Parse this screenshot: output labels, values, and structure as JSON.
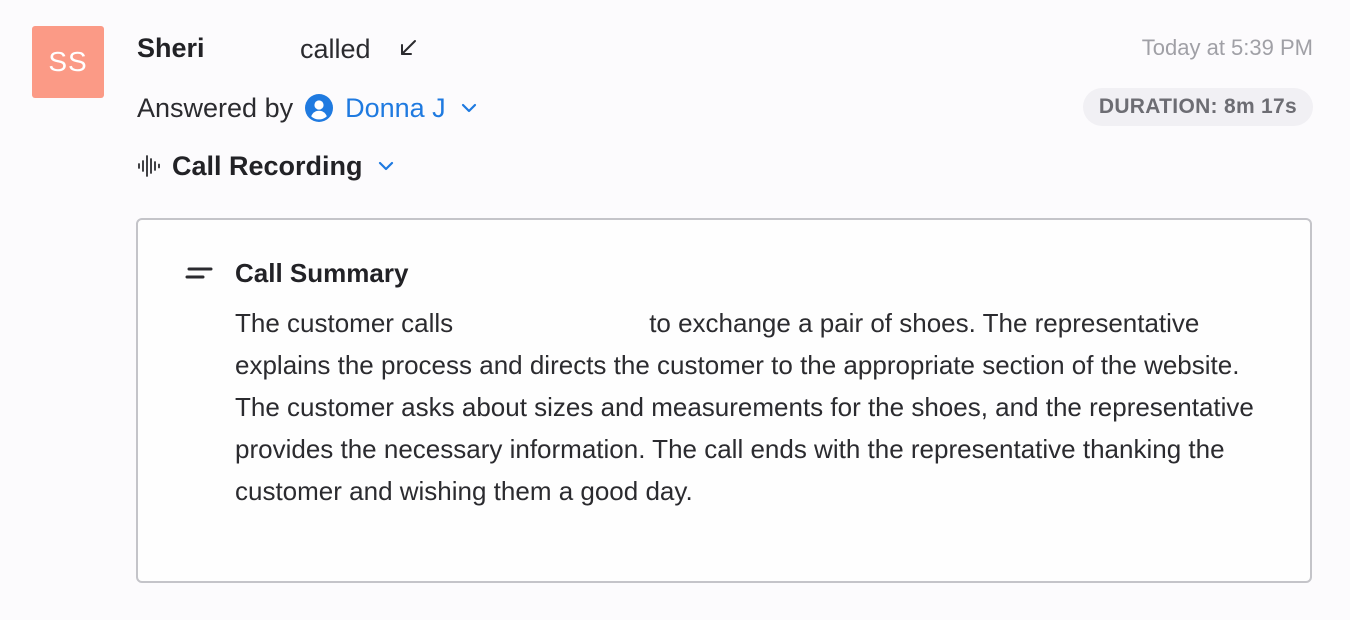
{
  "call": {
    "avatar_initials": "SS",
    "avatar_color": "#fb9a86",
    "caller_name": "Sheri",
    "action": "called",
    "direction_icon": "arrow-down-left-icon",
    "timestamp": "Today at 5:39 PM"
  },
  "answered": {
    "label": "Answered by",
    "agent_icon": "user-circle-icon",
    "agent_name": "Donna J",
    "accent_color": "#1f7ae0"
  },
  "duration": {
    "text": "DURATION: 8m 17s"
  },
  "recording": {
    "icon": "audio-waveform-icon",
    "label": "Call Recording"
  },
  "summary": {
    "icon": "text-lines-icon",
    "title": "Call Summary",
    "body_start": "The customer calls",
    "body_rest": "to exchange a pair of shoes. The representative explains the process and directs the customer to the appropriate section of the website. The customer asks about sizes and measurements for the shoes, and the representative provides the necessary information. The call ends with the representative thanking the customer and wishing them a good day."
  }
}
